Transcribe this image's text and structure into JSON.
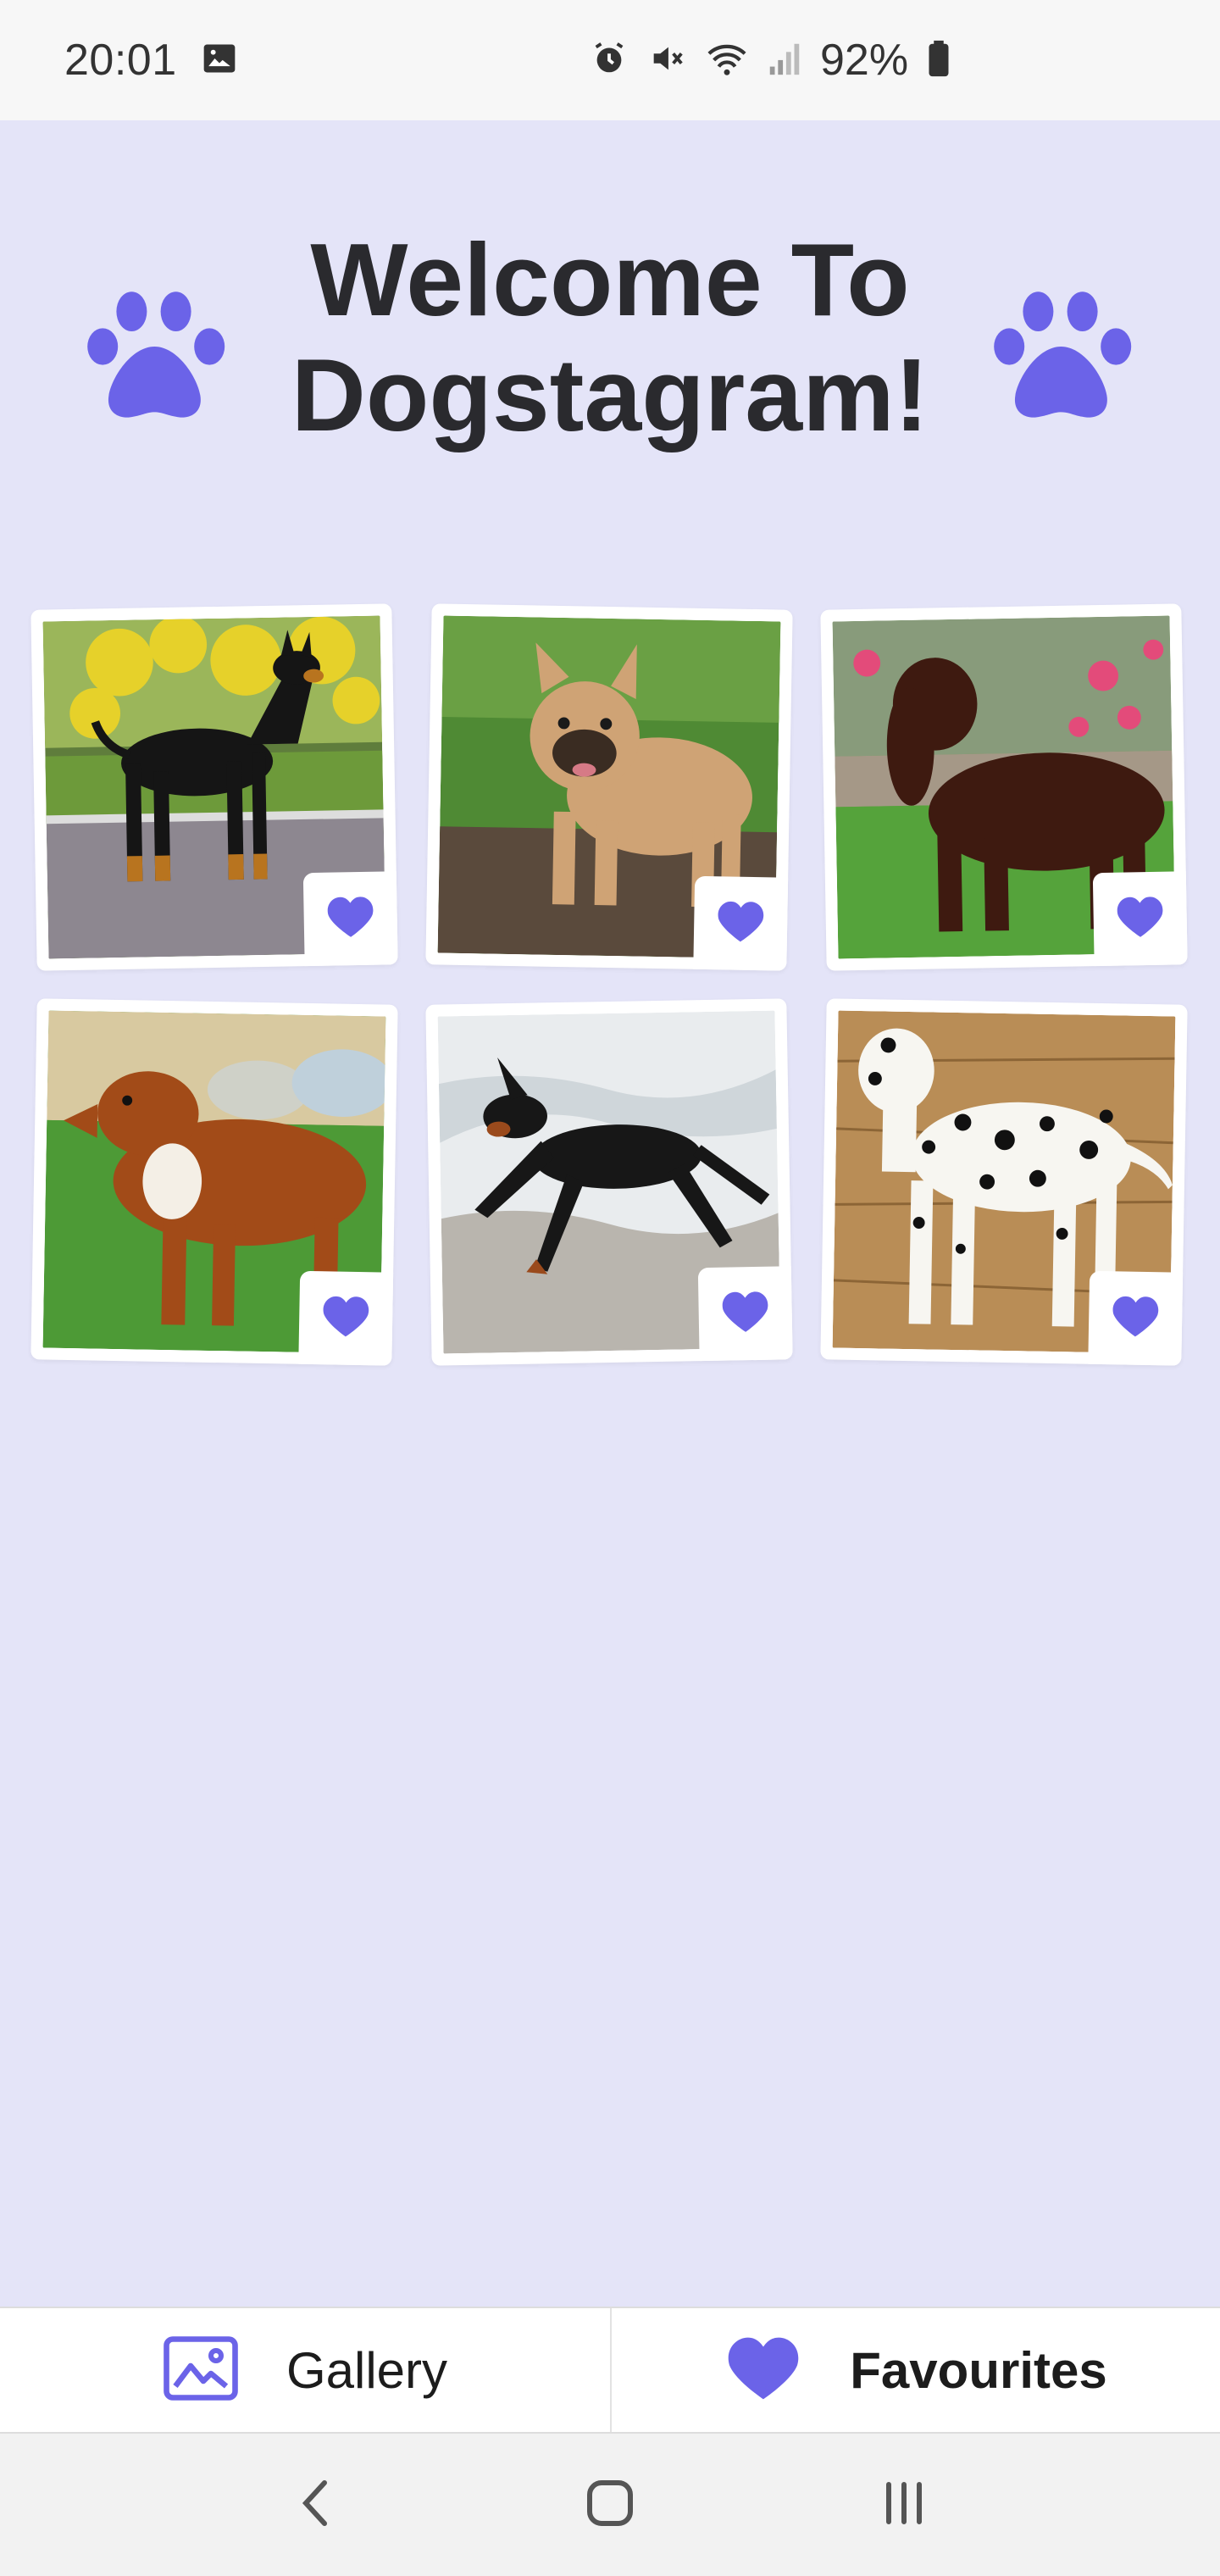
{
  "status_bar": {
    "time": "20:01",
    "battery": "92%",
    "icons": [
      "image-icon",
      "alarm-icon",
      "mute-icon",
      "wifi-icon",
      "signal-icon",
      "battery-icon"
    ]
  },
  "header": {
    "title": "Welcome To Dogstagram!",
    "accent_color": "#6b63e8"
  },
  "gallery": {
    "items": [
      {
        "breed_hint": "doberman",
        "favourite_icon": "heart-icon"
      },
      {
        "breed_hint": "french-bulldog",
        "favourite_icon": "heart-icon"
      },
      {
        "breed_hint": "spaniel",
        "favourite_icon": "heart-icon"
      },
      {
        "breed_hint": "collie-mix",
        "favourite_icon": "heart-icon"
      },
      {
        "breed_hint": "doberman-running",
        "favourite_icon": "heart-icon"
      },
      {
        "breed_hint": "dalmatian",
        "favourite_icon": "heart-icon"
      }
    ]
  },
  "tabbar": {
    "gallery_label": "Gallery",
    "favourites_label": "Favourites",
    "active": "Favourites"
  },
  "colors": {
    "background": "#e4e4f8",
    "accent": "#6b63e8",
    "text": "#2a2a2e"
  }
}
